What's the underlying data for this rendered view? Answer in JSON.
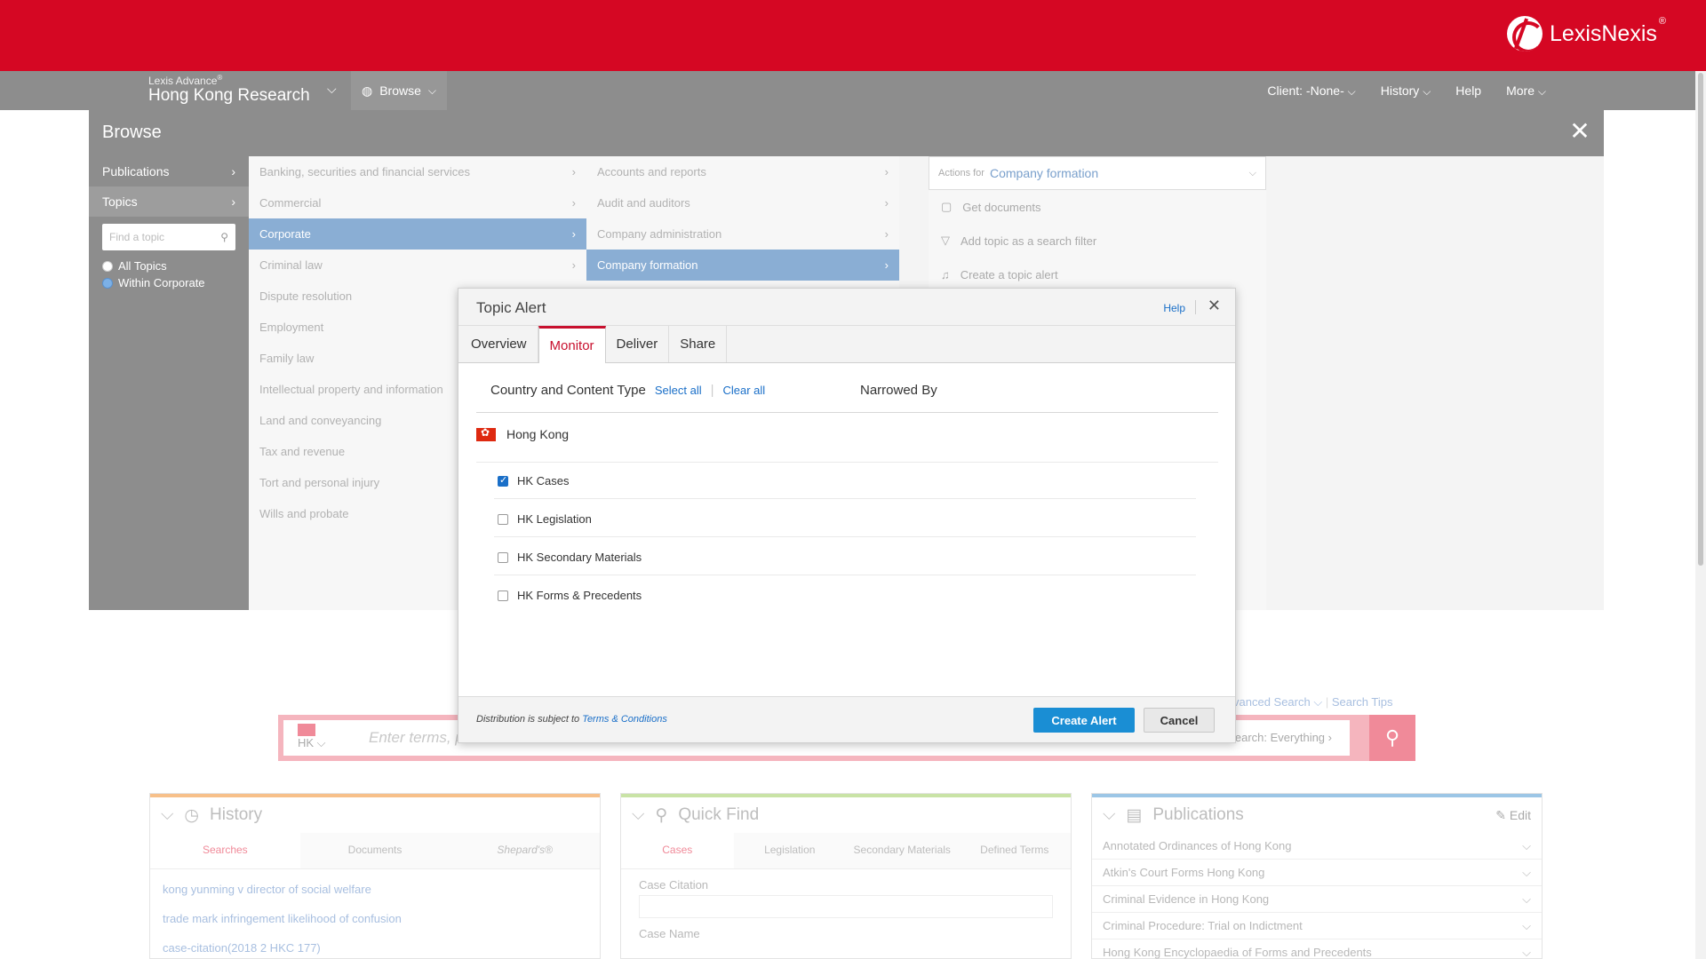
{
  "brand": {
    "name": "LexisNexis",
    "trademark": "®"
  },
  "nav": {
    "product_small": "Lexis Advance",
    "product_sup": "®",
    "product_title": "Hong Kong Research",
    "browse_label": "Browse",
    "client_label": "Client: -None-",
    "history_label": "History",
    "help_label": "Help",
    "more_label": "More"
  },
  "browse": {
    "title": "Browse",
    "left_items": [
      {
        "label": "Publications"
      },
      {
        "label": "Topics"
      }
    ],
    "find_placeholder": "Find a topic",
    "radios": [
      {
        "label": "All Topics",
        "selected": false
      },
      {
        "label": "Within Corporate",
        "selected": true
      }
    ],
    "col1": [
      {
        "label": "Banking, securities and financial services",
        "selected": false,
        "arrow": true
      },
      {
        "label": "Commercial",
        "selected": false,
        "arrow": true
      },
      {
        "label": "Corporate",
        "selected": true,
        "arrow": true
      },
      {
        "label": "Criminal law",
        "selected": false,
        "arrow": true
      },
      {
        "label": "Dispute resolution",
        "selected": false,
        "arrow": false
      },
      {
        "label": "Employment",
        "selected": false,
        "arrow": false
      },
      {
        "label": "Family law",
        "selected": false,
        "arrow": false
      },
      {
        "label": "Intellectual property and information",
        "selected": false,
        "arrow": false
      },
      {
        "label": "Land and conveyancing",
        "selected": false,
        "arrow": false
      },
      {
        "label": "Tax and revenue",
        "selected": false,
        "arrow": false
      },
      {
        "label": "Tort and personal injury",
        "selected": false,
        "arrow": false
      },
      {
        "label": "Wills and probate",
        "selected": false,
        "arrow": false
      }
    ],
    "col2": [
      {
        "label": "Accounts and reports",
        "selected": false
      },
      {
        "label": "Audit and auditors",
        "selected": false
      },
      {
        "label": "Company administration",
        "selected": false
      },
      {
        "label": "Company formation",
        "selected": true
      }
    ],
    "actions_for": "Actions for",
    "actions_topic": "Company formation",
    "actions": [
      {
        "label": "Get documents",
        "icon": "document-icon"
      },
      {
        "label": "Add topic as a search filter",
        "icon": "filter-icon"
      },
      {
        "label": "Create a topic alert",
        "icon": "bell-icon"
      }
    ]
  },
  "modal": {
    "title": "Topic Alert",
    "help": "Help",
    "tabs": [
      {
        "label": "Overview",
        "active": false
      },
      {
        "label": "Monitor",
        "active": true
      },
      {
        "label": "Deliver",
        "active": false
      },
      {
        "label": "Share",
        "active": false
      }
    ],
    "section_label": "Country and Content Type",
    "select_all": "Select all",
    "clear_all": "Clear all",
    "narrowed_by": "Narrowed By",
    "country": "Hong Kong",
    "options": [
      {
        "label": "HK Cases",
        "checked": true
      },
      {
        "label": "HK Legislation",
        "checked": false
      },
      {
        "label": "HK Secondary Materials",
        "checked": false
      },
      {
        "label": "HK Forms & Precedents",
        "checked": false
      }
    ],
    "dist_text": "Distribution is subject to",
    "terms": "Terms & Conditions",
    "create_label": "Create Alert",
    "cancel_label": "Cancel"
  },
  "search": {
    "country": "HK",
    "placeholder": "Enter terms, p",
    "scope": "Search: Everything",
    "advanced": "vanced Search",
    "tips": "Search Tips"
  },
  "history_card": {
    "title": "History",
    "tabs": [
      "Searches",
      "Documents",
      "Shepard's®"
    ],
    "items": [
      "kong yunming v director of social welfare",
      "trade mark infringement likelihood of confusion",
      "case-citation(2018 2 HKC 177)"
    ]
  },
  "quickfind_card": {
    "title": "Quick Find",
    "tabs": [
      "Cases",
      "Legislation",
      "Secondary Materials",
      "Defined Terms"
    ],
    "fields": [
      "Case Citation",
      "Case Name"
    ]
  },
  "pubs_card": {
    "title": "Publications",
    "edit": "Edit",
    "items": [
      "Annotated Ordinances of Hong Kong",
      "Atkin's Court Forms Hong Kong",
      "Criminal Evidence in Hong Kong",
      "Criminal Procedure: Trial on Indictment",
      "Hong Kong Encyclopaedia of Forms and Precedents"
    ]
  },
  "colors": {
    "brand_red": "#d50723",
    "link_blue": "#1a6fc8",
    "create_button": "#1a8ed4",
    "selection_blue": "#8aaed4"
  }
}
